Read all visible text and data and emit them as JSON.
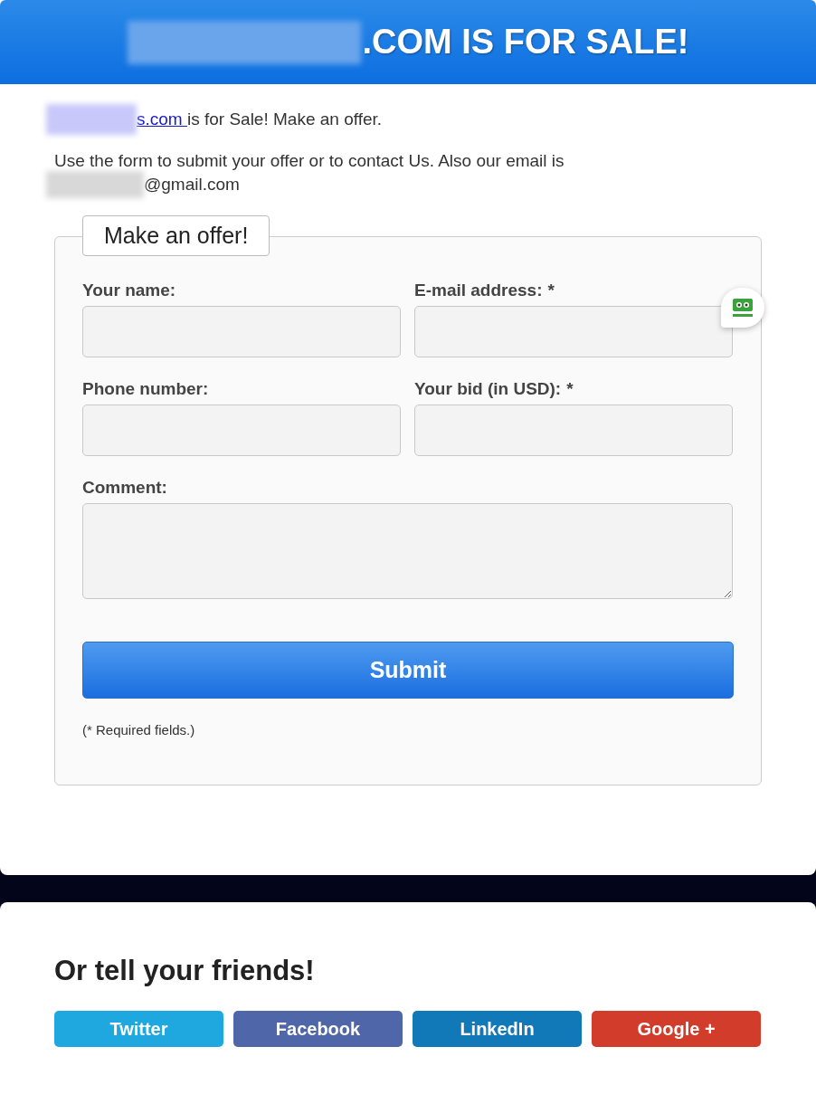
{
  "header": {
    "title": ".COM IS FOR SALE!"
  },
  "intro": {
    "link": "s.com ",
    "text": "is for Sale! Make an offer."
  },
  "contact": {
    "text": "Use the form to submit your offer or to contact Us. Also our email is",
    "email": "@gmail.com"
  },
  "form": {
    "legend": "Make an offer!",
    "fields": [
      {
        "kind": "input",
        "label": "Your name:"
      },
      {
        "kind": "input",
        "label": "E-mail address:",
        "mark": "*"
      },
      {
        "kind": "input",
        "label": "Phone number:"
      },
      {
        "kind": "input",
        "label": "Your bid (in USD):",
        "mark": "*"
      },
      {
        "kind": "textarea",
        "label": "Comment:"
      }
    ],
    "submit": "Submit",
    "note": "(* Required fields.)"
  },
  "share": {
    "title": "Or tell your friends!",
    "buttons": [
      {
        "label": "Twitter",
        "color": "#1fa8e0"
      },
      {
        "label": "Facebook",
        "color": "#4f67a8"
      },
      {
        "label": "LinkedIn",
        "color": "#1179b8"
      },
      {
        "label": "Google +",
        "color": "#d13c2b"
      }
    ]
  }
}
